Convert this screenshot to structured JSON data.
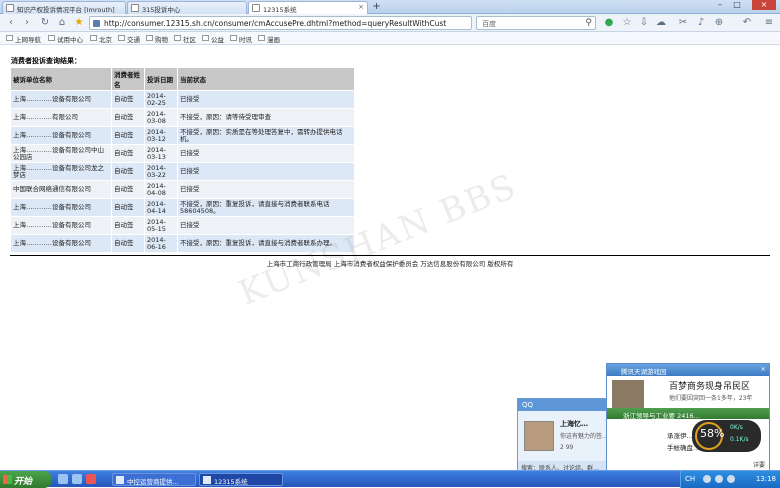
{
  "browser": {
    "tabs": [
      {
        "label": "知识产权投诉情况平台 [Imrouth]"
      },
      {
        "label": "315投诉中心"
      },
      {
        "label": "12315系统"
      }
    ],
    "new_tab": "+",
    "window_controls": {
      "minimize": "–",
      "maximize": "□",
      "close": "×"
    },
    "url": "http://consumer.12315.sh.cn/consumer/cmAccusePre.dhtml?method=queryResultWithCust",
    "search_placeholder": "百度",
    "bookmarks": [
      "上网导航",
      "试用中心",
      "北京",
      "交通",
      "购物",
      "社区",
      "公益",
      "时讯",
      "漫画"
    ]
  },
  "page": {
    "heading": "消费者投诉查询结果：",
    "columns": [
      "被诉单位名称",
      "消费者姓名",
      "投诉日期",
      "当前状态"
    ],
    "rows": [
      {
        "company": "上海…………设备有限公司",
        "consumer": "自动签",
        "date": "2014-02-25",
        "status": "已接受"
      },
      {
        "company": "上海…………有限公司",
        "consumer": "自动签",
        "date": "2014-03-08",
        "status": "不接受，原因：请等待受理审查"
      },
      {
        "company": "上海…………设备有限公司",
        "consumer": "自动签",
        "date": "2014-03-12",
        "status": "不接受，原因：实质是在等处理答复中，需转办提供电话机。"
      },
      {
        "company": "上海…………设备有限公司中山公园店",
        "consumer": "自动签",
        "date": "2014-03-13",
        "status": "已接受"
      },
      {
        "company": "上海…………设备有限公司龙之梦店",
        "consumer": "自动签",
        "date": "2014-03-22",
        "status": "已接受"
      },
      {
        "company": "中国联合网络通信有限公司",
        "consumer": "自动签",
        "date": "2014-04-08",
        "status": "已接受"
      },
      {
        "company": "上海…………设备有限公司",
        "consumer": "自动签",
        "date": "2014-04-14",
        "status": "不接受，原因：重复投诉，请直接与消费者联系电话58604508。"
      },
      {
        "company": "上海…………设备有限公司",
        "consumer": "自动签",
        "date": "2014-05-15",
        "status": "已接受"
      },
      {
        "company": "上海…………设备有限公司",
        "consumer": "自动签",
        "date": "2014-06-16",
        "status": "不接受，原因：重复投诉，请直接与消费者联系办理。"
      }
    ],
    "footer": "上海市工商行政管理局   上海市消费者权益保护委员会   万达信息股份有限公司   版权所有",
    "watermark": "KUNSHAN BBS"
  },
  "qq_popup": {
    "title": "QQ",
    "name": "上海忆…",
    "subtitle": "你这有魅力的签…",
    "counts": "2  99",
    "bottom": "搜索：联系人、讨论组、群…"
  },
  "news_popup": {
    "title": "腾讯天湖游戏园",
    "headline": "百梦商务现身吊民区",
    "sub": "他们要因突回一条1多年，23年",
    "bar2": "浙江领导与工业要 2416…",
    "line1": "承涨伊…",
    "line2": "手帐确盘…",
    "more": "详要"
  },
  "speed_widget": {
    "percent": "58%",
    "up": "0K/s",
    "down": "0.1K/s"
  },
  "taskbar": {
    "start_label": "开始",
    "tasks": [
      {
        "label": "中控运营商提供..."
      },
      {
        "label": "12315系统"
      }
    ],
    "ime": "CH",
    "clock": "13:18"
  }
}
